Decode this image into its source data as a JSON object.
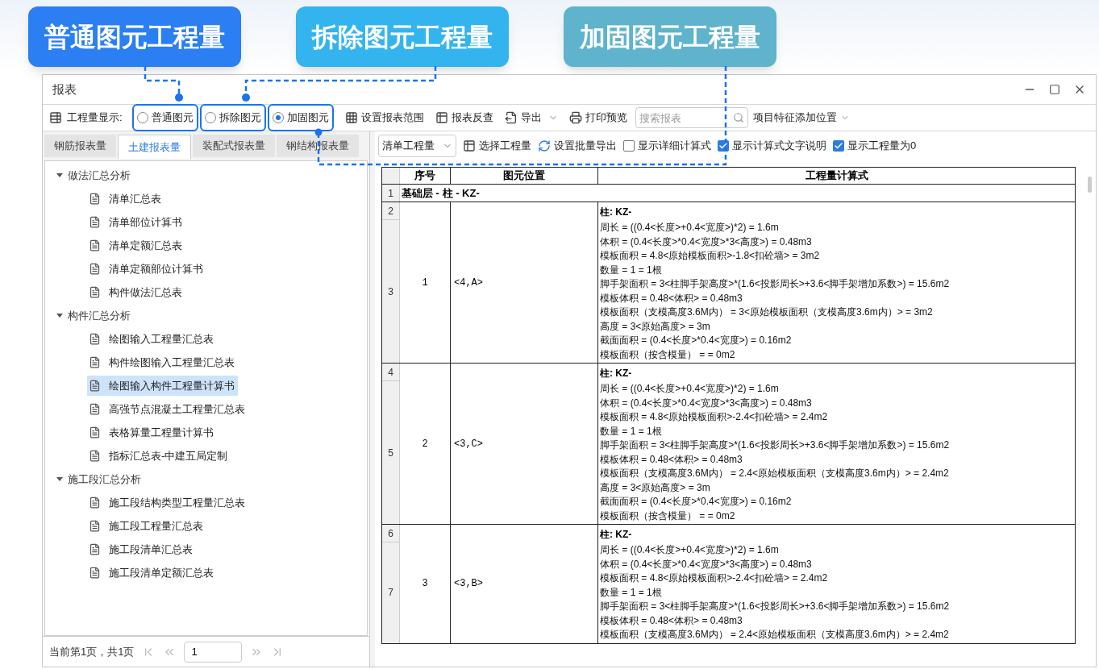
{
  "callouts": [
    {
      "label": "普通图元工程量",
      "color": "#2b7ff2"
    },
    {
      "label": "拆除图元工程量",
      "color": "#34b4ee"
    },
    {
      "label": "加固图元工程量",
      "color": "#5fb3cc"
    }
  ],
  "window": {
    "title": "报表"
  },
  "toolbar": {
    "display_label": "工程量显示:",
    "radios": [
      {
        "label": "普通图元",
        "selected": false
      },
      {
        "label": "拆除图元",
        "selected": false
      },
      {
        "label": "加固图元",
        "selected": true
      }
    ],
    "buttons": [
      {
        "kind": "range",
        "label": "设置报表范围"
      },
      {
        "kind": "lookup",
        "label": "报表反查"
      },
      {
        "kind": "export",
        "label": "导出"
      },
      {
        "kind": "print",
        "label": "打印预览"
      }
    ],
    "search": {
      "placeholder": "搜索报表"
    },
    "position_dropdown": "项目特征添加位置"
  },
  "tabs": [
    {
      "label": "钢筋报表量",
      "selected": false
    },
    {
      "label": "土建报表量",
      "selected": true
    },
    {
      "label": "装配式报表量",
      "selected": false
    },
    {
      "label": "钢结构报表量",
      "selected": false
    }
  ],
  "tree": [
    {
      "label": "做法汇总分析",
      "expanded": true,
      "children": [
        {
          "label": "清单汇总表",
          "selected": false
        },
        {
          "label": "清单部位计算书",
          "selected": false
        },
        {
          "label": "清单定额汇总表",
          "selected": false
        },
        {
          "label": "清单定额部位计算书",
          "selected": false
        },
        {
          "label": "构件做法汇总表",
          "selected": false
        }
      ]
    },
    {
      "label": "构件汇总分析",
      "expanded": true,
      "children": [
        {
          "label": "绘图输入工程量汇总表",
          "selected": false
        },
        {
          "label": "构件绘图输入工程量汇总表",
          "selected": false
        },
        {
          "label": "绘图输入构件工程量计算书",
          "selected": true
        },
        {
          "label": "高强节点混凝土工程量汇总表",
          "selected": false
        },
        {
          "label": "表格算量工程量计算书",
          "selected": false
        },
        {
          "label": "指标汇总表-中建五局定制",
          "selected": false
        }
      ]
    },
    {
      "label": "施工段汇总分析",
      "expanded": true,
      "children": [
        {
          "label": "施工段结构类型工程量汇总表",
          "selected": false
        },
        {
          "label": "施工段工程量汇总表",
          "selected": false
        },
        {
          "label": "施工段清单汇总表",
          "selected": false
        },
        {
          "label": "施工段清单定额汇总表",
          "selected": false
        }
      ]
    }
  ],
  "pager": {
    "text": "当前第1页，共1页",
    "page": "1"
  },
  "report_toolbar": {
    "quantity_select": "清单工程量",
    "buttons": [
      "选择工程量",
      "设置批量导出"
    ],
    "checkboxes": [
      {
        "label": "显示详细计算式",
        "checked": false
      },
      {
        "label": "显示计算式文字说明",
        "checked": true
      },
      {
        "label": "显示工程量为0",
        "checked": true
      }
    ]
  },
  "table": {
    "columns": [
      "序号",
      "图元位置",
      "工程量计算式"
    ],
    "group_row": {
      "row_number": "1",
      "text": "基础层 - 柱 - KZ-"
    },
    "records": [
      {
        "row_numbers": [
          "2",
          "3"
        ],
        "index": "1",
        "position": "<4,A>",
        "title": "柱: KZ-",
        "lines": [
          "周长 = ((0.4<长度>+0.4<宽度>)*2) = 1.6m",
          "体积 = (0.4<长度>*0.4<宽度>*3<高度>) = 0.48m3",
          "模板面积 = 4.8<原始模板面积>-1.8<扣砼墙> = 3m2",
          "数量 = 1 = 1根",
          "脚手架面积 = 3<柱脚手架高度>*(1.6<投影周长>+3.6<脚手架增加系数>) = 15.6m2",
          "模板体积 = 0.48<体积> = 0.48m3",
          "模板面积（支模高度3.6M内） = 3<原始模板面积（支模高度3.6m内）> = 3m2",
          "高度 = 3<原始高度> = 3m",
          "截面面积 = (0.4<长度>*0.4<宽度>) = 0.16m2",
          "模板面积（按含模量） = = 0m2"
        ]
      },
      {
        "row_numbers": [
          "4",
          "5"
        ],
        "index": "2",
        "position": "<3,C>",
        "title": "柱: KZ-",
        "lines": [
          "周长 = ((0.4<长度>+0.4<宽度>)*2) = 1.6m",
          "体积 = (0.4<长度>*0.4<宽度>*3<高度>) = 0.48m3",
          "模板面积 = 4.8<原始模板面积>-2.4<扣砼墙> = 2.4m2",
          "数量 = 1 = 1根",
          "脚手架面积 = 3<柱脚手架高度>*(1.6<投影周长>+3.6<脚手架增加系数>) = 15.6m2",
          "模板体积 = 0.48<体积> = 0.48m3",
          "模板面积（支模高度3.6M内） = 2.4<原始模板面积（支模高度3.6m内）> = 2.4m2",
          "高度 = 3<原始高度> = 3m",
          "截面面积 = (0.4<长度>*0.4<宽度>) = 0.16m2",
          "模板面积（按含模量） = = 0m2"
        ]
      },
      {
        "row_numbers": [
          "6",
          "7"
        ],
        "index": "3",
        "position": "<3,B>",
        "title": "柱: KZ-",
        "lines": [
          "周长 = ((0.4<长度>+0.4<宽度>)*2) = 1.6m",
          "体积 = (0.4<长度>*0.4<宽度>*3<高度>) = 0.48m3",
          "模板面积 = 4.8<原始模板面积>-2.4<扣砼墙> = 2.4m2",
          "数量 = 1 = 1根",
          "脚手架面积 = 3<柱脚手架高度>*(1.6<投影周长>+3.6<脚手架增加系数>) = 15.6m2",
          "模板体积 = 0.48<体积> = 0.48m3",
          "模板面积（支模高度3.6M内） = 2.4<原始模板面积（支模高度3.6m内）> = 2.4m2"
        ]
      }
    ]
  }
}
